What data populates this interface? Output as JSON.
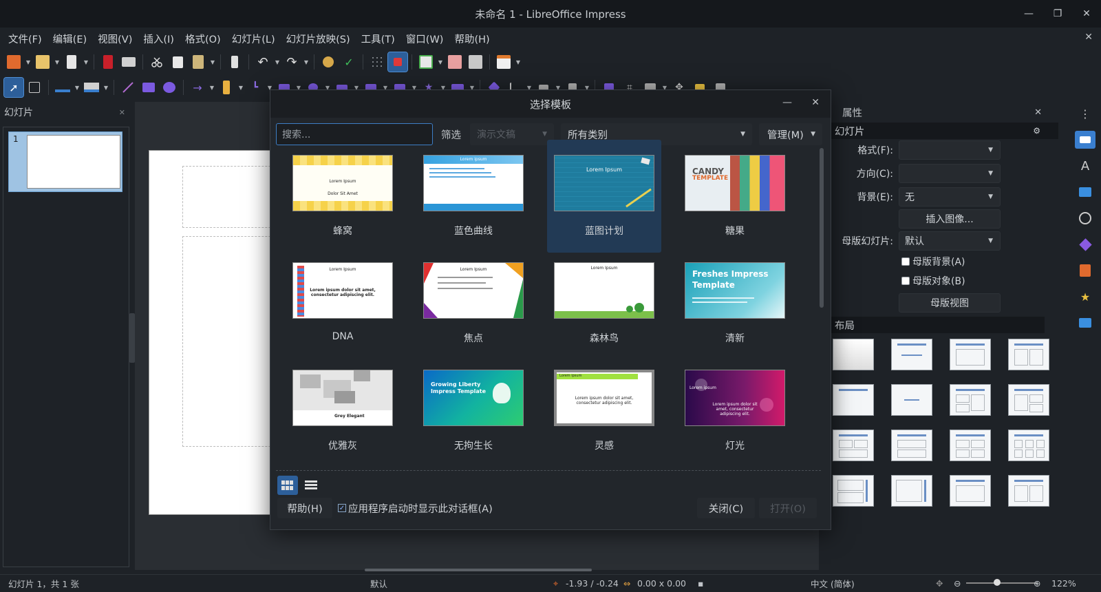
{
  "window": {
    "title": "未命名 1 - LibreOffice Impress"
  },
  "menu": [
    "文件(F)",
    "编辑(E)",
    "视图(V)",
    "插入(I)",
    "格式(O)",
    "幻灯片(L)",
    "幻灯片放映(S)",
    "工具(T)",
    "窗口(W)",
    "帮助(H)"
  ],
  "slides_panel": {
    "title": "幻灯片",
    "slides": [
      {
        "number": "1"
      }
    ]
  },
  "properties": {
    "title": "属性",
    "section_slide": "幻灯片",
    "format_label": "格式(F):",
    "format_value": "",
    "orientation_label": "方向(C):",
    "orientation_value": "",
    "background_label": "背景(E):",
    "background_value": "无",
    "insert_image": "插入图像...",
    "master_label": "母版幻灯片:",
    "master_value": "默认",
    "master_bg": "母版背景(A)",
    "master_obj": "母版对象(B)",
    "master_view": "母版视图",
    "section_layout": "布局"
  },
  "dialog": {
    "title": "选择模板",
    "search_placeholder": "搜索...",
    "filter_label": "筛选",
    "filter_value": "演示文稿",
    "category_value": "所有类别",
    "manage": "管理(M)",
    "templates": [
      {
        "name": "蜂窝",
        "selected": false
      },
      {
        "name": "蓝色曲线",
        "selected": false
      },
      {
        "name": "蓝图计划",
        "selected": true
      },
      {
        "name": "糖果",
        "selected": false
      },
      {
        "name": "DNA",
        "selected": false
      },
      {
        "name": "焦点",
        "selected": false
      },
      {
        "name": "森林鸟",
        "selected": false
      },
      {
        "name": "清新",
        "selected": false
      },
      {
        "name": "优雅灰",
        "selected": false
      },
      {
        "name": "无拘生长",
        "selected": false
      },
      {
        "name": "灵感",
        "selected": false
      },
      {
        "name": "灯光",
        "selected": false
      }
    ],
    "thumb_text": {
      "lorem": "Lorem Ipsum",
      "lorem_lc": "Lorem ipsum",
      "dolor": "Dolor Sit Amet",
      "candy": "CANDY",
      "candy2": "TEMPLATE",
      "fresh": "Freshes Impress Template",
      "growing": "Growing Liberty Impress Template",
      "grey": "Grey Elegant",
      "body": "Lorem ipsum dolor sit amet, consectetur adipiscing elit."
    },
    "help": "帮助(H)",
    "startup_checkbox": "应用程序启动时显示此对话框(A)",
    "startup_checked": true,
    "close": "关闭(C)",
    "open": "打开(O)"
  },
  "status": {
    "slide_info": "幻灯片 1，共 1 张",
    "master": "默认",
    "position": "-1.93 / -0.24",
    "size": "0.00 x 0.00",
    "language": "中文 (简体)",
    "zoom": "122%"
  },
  "icons": [
    "new-icon",
    "open-icon",
    "save-icon",
    "pdf-icon",
    "print-icon",
    "cut-icon",
    "copy-icon",
    "paste-icon",
    "clone-icon",
    "undo-icon",
    "redo-icon",
    "spellcheck-icon",
    "grid-icon",
    "display-icon",
    "new-slide-icon",
    "duplicate-slide-icon",
    "delete-slide-icon",
    "layout-icon"
  ]
}
